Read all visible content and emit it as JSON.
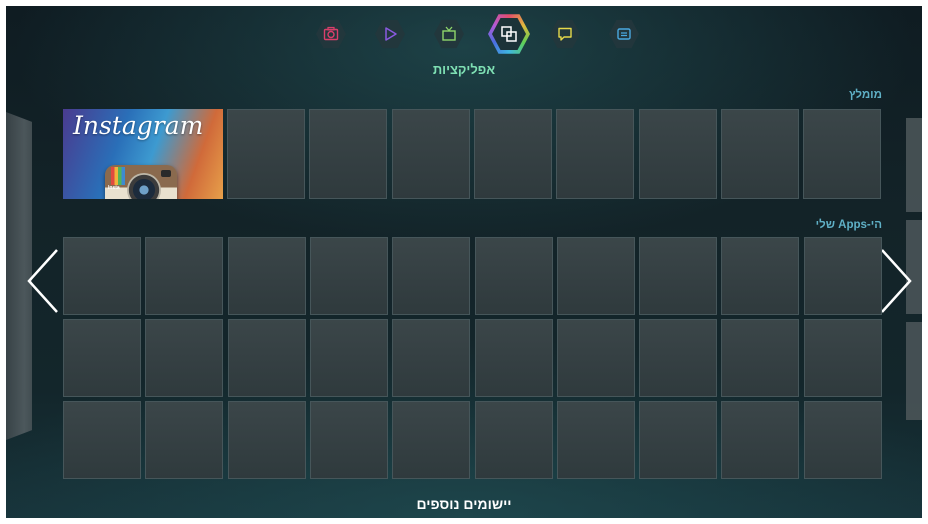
{
  "category_bar": {
    "icons": [
      {
        "name": "photos",
        "icon": "camera-icon",
        "color": "#d93f6b"
      },
      {
        "name": "videos",
        "icon": "play-icon",
        "color": "#8a5ae0"
      },
      {
        "name": "tv",
        "icon": "tv-icon",
        "color": "#8ed56b"
      },
      {
        "name": "apps",
        "icon": "apps-icon",
        "color": "#ffffff",
        "active": true
      },
      {
        "name": "social",
        "icon": "chat-icon",
        "color": "#e6d84a"
      },
      {
        "name": "info",
        "icon": "panel-icon",
        "color": "#4aa8e0"
      }
    ]
  },
  "page": {
    "title": "אפליקציות",
    "footer_button": "יישומים נוספים"
  },
  "sections": {
    "recommended": {
      "label": "מומלץ",
      "featured_app": {
        "name": "Instagram",
        "logo_text": "Instagram",
        "badge": "Insta"
      },
      "empty_tile_count": 8
    },
    "my_apps": {
      "label": "הי-Apps שלי",
      "rows": 3,
      "columns": 10
    }
  },
  "colors": {
    "accent_title": "#7fe0b4",
    "section_label": "#5fb0c6",
    "background": "#132328"
  }
}
